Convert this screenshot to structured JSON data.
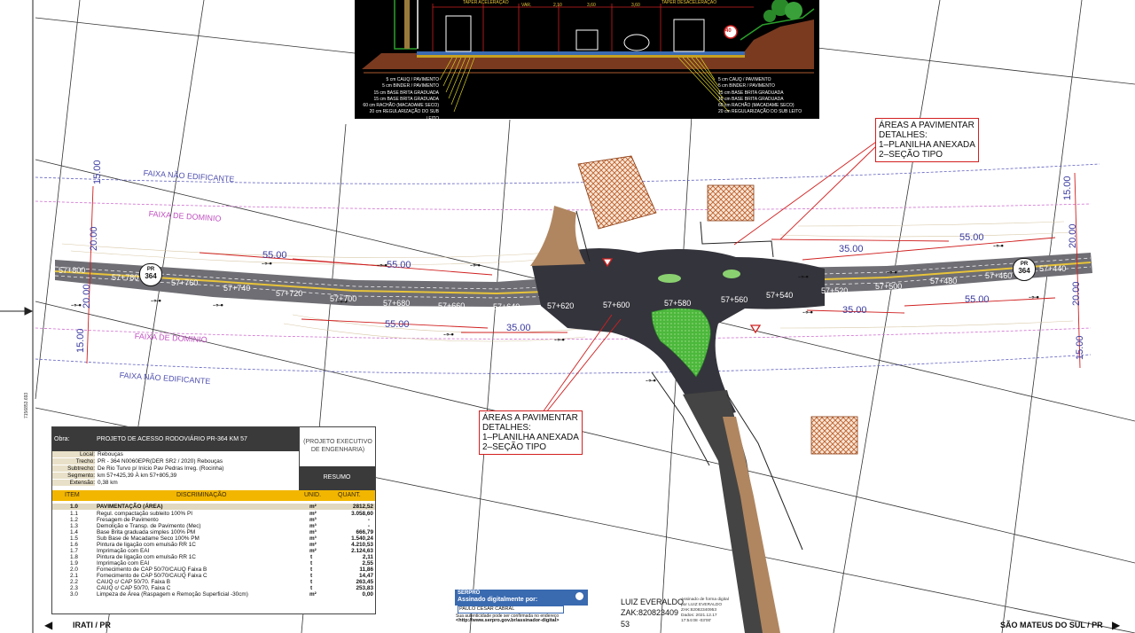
{
  "colors": {
    "road": "#6b6b70",
    "road_dark": "#3c3c44",
    "median": "#e8c43a",
    "dirt": "#b08660",
    "green": "#5bc04a",
    "dim_blue": "#3a3aa0",
    "dim_red": "#d02020",
    "zone_magenta": "#d070d0",
    "table_header": "#3a3a3a",
    "table_yellow": "#f2b600"
  },
  "section": {
    "labels": [
      "TAPER ACELERAÇÃO",
      "VAR.",
      "2,10",
      "3,60",
      "3,60",
      "TAPER DESACELERAÇÃO"
    ],
    "left_layers": [
      "5 cm CAUQ / PAVIMENTO",
      "5 cm BINDER / PAVIMENTO",
      "15 cm BASE BRITA GRADUADA",
      "15 cm BASE BRITA GRADUADA",
      "60 cm RACHÃO (MACADAME SECO)",
      "20 cm REGULARIZAÇÃO DO SUB LEITO"
    ],
    "right_layers": [
      "5 cm CAUQ / PAVIMENTO",
      "5 cm BINDER / PAVIMENTO",
      "15 cm BASE BRITA GRADUADA",
      "15 cm BASE BRITA GRADUADA",
      "60 cm RACHÃO (MACADAME SECO)",
      "20 cm REGULARIZAÇÃO DO SUB LEITO"
    ],
    "sign_value": "40"
  },
  "zones": {
    "faixa_nao_edificante": "FAIXA NÃO EDIFICANTE",
    "faixa_de_dominio": "FAIXA DE DOMINIO"
  },
  "dims": {
    "d15": "15.00",
    "d20": "20.00",
    "d55": "55.00",
    "d35": "35.00"
  },
  "road": {
    "shield_top": "PR",
    "shield_num": "364",
    "stations": [
      "57+800",
      "57+780",
      "57+760",
      "57+740",
      "57+720",
      "57+700",
      "57+680",
      "57+660",
      "57+640",
      "57+620",
      "57+600",
      "57+580",
      "57+560",
      "57+540",
      "57+520",
      "57+500",
      "57+480",
      "57+460",
      "57+440"
    ]
  },
  "callout": {
    "lines": [
      "ÁREAS A PAVIMENTAR",
      "DETALHES:",
      "1–PLANILHA ANEXADA",
      "2–SEÇÃO TIPO"
    ]
  },
  "side_text": "7156853.693",
  "table": {
    "obra_label": "Obra:",
    "obra_value": "PROJETO DE ACESSO RODOVIÁRIO PR-364 KM 57",
    "right_title": "(PROJETO EXECUTIVO DE ENGENHARIA)",
    "resumo": "RESUMO",
    "info": [
      {
        "label": "Local:",
        "value": "Rebouças"
      },
      {
        "label": "Trecho:",
        "value": "PR - 364 N0060EPR(DER SR2 / 2020) Rebouças"
      },
      {
        "label": "Subtrecho:",
        "value": "De Rio Turvo p/ Início Pav Pedras Irreg. (Rocinha)"
      },
      {
        "label": "Segmento:",
        "value": "km 57+425,39    À    km 57+805,39"
      },
      {
        "label": "Extensão:",
        "value": "0,38 km"
      }
    ],
    "col_item": "ITEM",
    "col_disc": "DISCRIMINAÇÃO",
    "col_unid": "UNID.",
    "col_quant": "QUANT.",
    "rows": [
      {
        "item": "1.0",
        "desc": "PAVIMENTAÇÃO   (ÁREA)",
        "unid": "m²",
        "quant": "2812,52"
      },
      {
        "item": "1.1",
        "desc": "Regul. compactação subleito 100% PI",
        "unid": "m²",
        "quant": "3.058,60"
      },
      {
        "item": "1.2",
        "desc": "Fresagem de Pavimento",
        "unid": "m³",
        "quant": "-"
      },
      {
        "item": "1.3",
        "desc": "Demolição e Transp. de Pavimento (Mec)",
        "unid": "m³",
        "quant": "-"
      },
      {
        "item": "1.4",
        "desc": "Base Brita graduada simples 100% PM",
        "unid": "m³",
        "quant": "666,79"
      },
      {
        "item": "1.5",
        "desc": "Sub Base de Macadame Seco 100% PM",
        "unid": "m³",
        "quant": "1.540,24"
      },
      {
        "item": "1.6",
        "desc": "Pintura de ligação com emulsão RR 1C",
        "unid": "m²",
        "quant": "4.210,53"
      },
      {
        "item": "1.7",
        "desc": "Imprimação com EAI",
        "unid": "m²",
        "quant": "2.124,63"
      },
      {
        "item": "1.8",
        "desc": "Pintura de ligação com emulsão RR 1C",
        "unid": "t",
        "quant": "2,11"
      },
      {
        "item": "1.9",
        "desc": "Imprimação com EAI",
        "unid": "t",
        "quant": "2,55"
      },
      {
        "item": "2.0",
        "desc": "Fornecimento de CAP 50/70/CAUQ Faixa B",
        "unid": "t",
        "quant": "11,86"
      },
      {
        "item": "2.1",
        "desc": "Fornecimento de CAP 50/70/CAUQ Faixa C",
        "unid": "t",
        "quant": "14,47"
      },
      {
        "item": "2.2",
        "desc": "CAUQ c/ CAP 50/70. Faixa B",
        "unid": "t",
        "quant": "263,45"
      },
      {
        "item": "2.3",
        "desc": "CAUQ c/ CAP 50/70, Faixa C",
        "unid": "t",
        "quant": "253,83"
      },
      {
        "item": "3.0",
        "desc": "Limpeza de Área (Raspagem e Remoção Superficial -30cm)",
        "unid": "m²",
        "quant": "0,00"
      }
    ]
  },
  "serpro": {
    "logo": "SERPRO",
    "signed_label": "Assinado digitalmente por:",
    "signer": "PAULO CESAR CABRAL",
    "note1": "Sua autenticidade pode ser confirmada no endereço",
    "note2": "<http://www.serpro.gov.br/assinador-digital>"
  },
  "signature": {
    "name": "LUIZ EVERALDO",
    "code": "ZAK:820823409",
    "suffix": "53",
    "d1": "Assinado de forma digital",
    "d2": "por LUIZ EVERALDO",
    "d3": "ZAK:82082340953",
    "d4": "Dados: 2021.12.17",
    "d5": "17:54:08 -03'00'"
  },
  "footer": {
    "left": "IRATI / PR",
    "right": "SÃO MATEUS DO SUL / PR"
  }
}
